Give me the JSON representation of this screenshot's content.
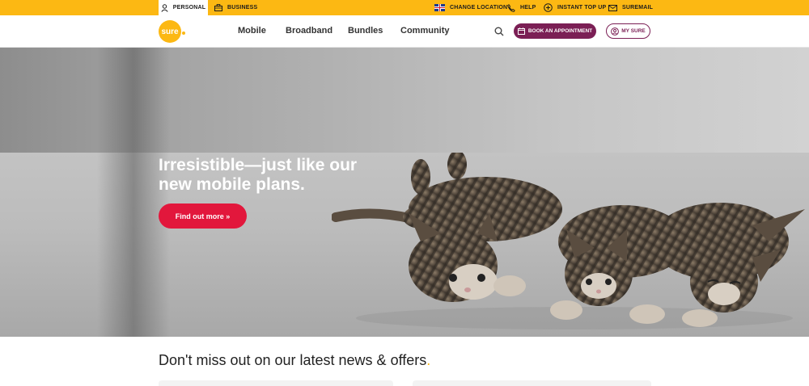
{
  "topbar": {
    "personal": "PERSONAL",
    "business": "BUSINESS",
    "change_location": "CHANGE LOCATION",
    "help": "HELP",
    "instant_top_up": "INSTANT TOP UP",
    "suremail": "SUREMAIL",
    "bar_color": "#fcb813"
  },
  "logo": {
    "text": "sure"
  },
  "nav": {
    "items": [
      "Mobile",
      "Broadband",
      "Bundles",
      "Community"
    ],
    "book_appointment": "BOOK AN APPOINTMENT",
    "my_sure": "MY SURE",
    "brand_color": "#7b1f55"
  },
  "hero": {
    "title": "Irresistible—just like our new mobile plans.",
    "cta": "Find out more »",
    "cta_color": "#e2173c",
    "image_icon": "kittens-image"
  },
  "news": {
    "title": "Don't miss out on our latest news & offers",
    "title_dot": "."
  },
  "icons": [
    "user-icon",
    "briefcase-icon",
    "flag-icon",
    "phone-icon",
    "plus-circle-icon",
    "mail-icon",
    "search-icon",
    "calendar-icon",
    "account-icon"
  ]
}
